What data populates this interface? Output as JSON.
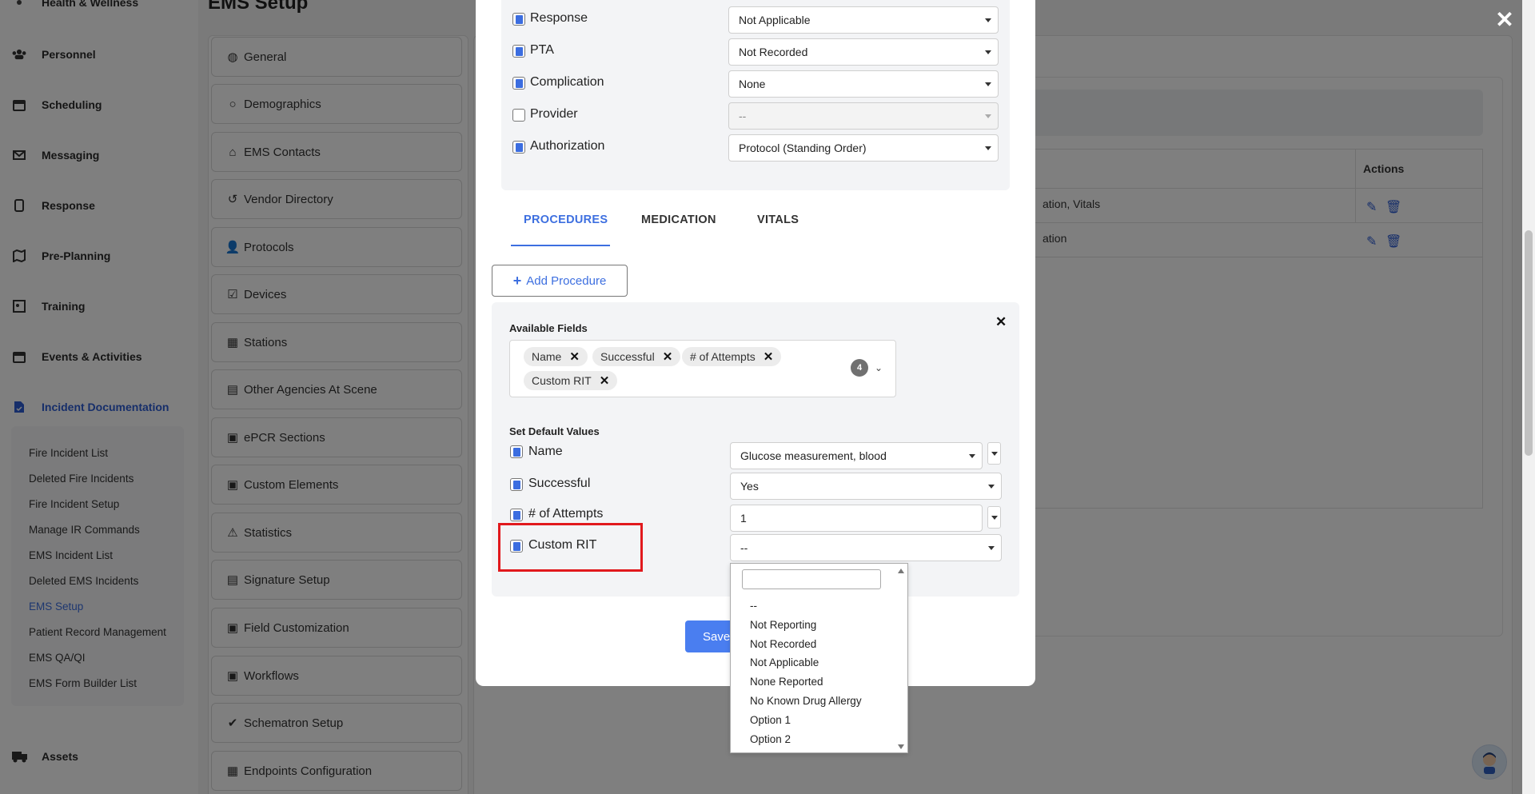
{
  "sidebar": {
    "top_partial": "Health & Wellness",
    "items": [
      {
        "label": "Personnel",
        "icon": "users-icon"
      },
      {
        "label": "Scheduling",
        "icon": "calendar-icon"
      },
      {
        "label": "Messaging",
        "icon": "mail-icon"
      },
      {
        "label": "Response",
        "icon": "phone-icon"
      },
      {
        "label": "Pre-Planning",
        "icon": "map-icon"
      },
      {
        "label": "Training",
        "icon": "training-icon"
      },
      {
        "label": "Events & Activities",
        "icon": "calendar-icon"
      },
      {
        "label": "Incident Documentation",
        "icon": "document-icon"
      },
      {
        "label": "Assets",
        "icon": "truck-icon"
      }
    ],
    "subitems": [
      "Fire Incident List",
      "Deleted Fire Incidents",
      "Fire Incident Setup",
      "Manage IR Commands",
      "EMS Incident List",
      "Deleted EMS Incidents",
      "EMS Setup",
      "Patient Record Management",
      "EMS QA/QI",
      "EMS Form Builder List"
    ],
    "active_subitem": "EMS Setup"
  },
  "page": {
    "title": "EMS Setup"
  },
  "setup_menu": [
    {
      "label": "General",
      "icon": "globe-icon"
    },
    {
      "label": "Demographics",
      "icon": "circle-icon"
    },
    {
      "label": "EMS Contacts",
      "icon": "home-icon"
    },
    {
      "label": "Vendor Directory",
      "icon": "history-icon"
    },
    {
      "label": "Protocols",
      "icon": "user-icon"
    },
    {
      "label": "Devices",
      "icon": "check-square-icon"
    },
    {
      "label": "Stations",
      "icon": "building-icon"
    },
    {
      "label": "Other Agencies At Scene",
      "icon": "file-icon"
    },
    {
      "label": "ePCR Sections",
      "icon": "calendar-icon"
    },
    {
      "label": "Custom Elements",
      "icon": "calendar-icon"
    },
    {
      "label": "Statistics",
      "icon": "warning-icon"
    },
    {
      "label": "Signature Setup",
      "icon": "file-icon"
    },
    {
      "label": "Field Customization",
      "icon": "calendar-icon"
    },
    {
      "label": "Workflows",
      "icon": "calendar-icon"
    },
    {
      "label": "Schematron Setup",
      "icon": "check-circle-icon"
    },
    {
      "label": "Endpoints Configuration",
      "icon": "building-icon"
    }
  ],
  "background": {
    "table_header_actions": "Actions",
    "row1_text": "ation, Vitals",
    "row2_text": "ation"
  },
  "modal": {
    "top_fields": [
      {
        "label": "Response",
        "value": "Not Applicable",
        "checked": true,
        "disabled": false
      },
      {
        "label": "PTA",
        "value": "Not Recorded",
        "checked": true,
        "disabled": false
      },
      {
        "label": "Complication",
        "value": "None",
        "checked": true,
        "disabled": false
      },
      {
        "label": "Provider",
        "value": "--",
        "checked": false,
        "disabled": true
      },
      {
        "label": "Authorization",
        "value": "Protocol (Standing Order)",
        "checked": true,
        "disabled": false
      }
    ],
    "tabs": [
      "PROCEDURES",
      "MEDICATION",
      "VITALS"
    ],
    "active_tab": "PROCEDURES",
    "add_button": "Add Procedure",
    "available_fields_title": "Available Fields",
    "chips": [
      "Name",
      "Successful",
      "# of Attempts",
      "Custom RIT"
    ],
    "chip_count": "4",
    "default_values_title": "Set Default Values",
    "default_fields": [
      {
        "label": "Name",
        "value": "Glucose measurement, blood",
        "checked": true
      },
      {
        "label": "Successful",
        "value": "Yes",
        "checked": true
      },
      {
        "label": "# of Attempts",
        "value": "1",
        "checked": true
      },
      {
        "label": "Custom RIT",
        "value": "--",
        "checked": true
      }
    ],
    "save_label": "Save"
  },
  "dropdown": {
    "search_placeholder": "",
    "options": [
      "--",
      "Not Reporting",
      "Not Recorded",
      "Not Applicable",
      "None Reported",
      "No Known Drug Allergy",
      "Option 1",
      "Option 2"
    ]
  },
  "colors": {
    "accent": "#3d6fe0",
    "highlight": "#e1191d",
    "save": "#4a7ef0"
  }
}
